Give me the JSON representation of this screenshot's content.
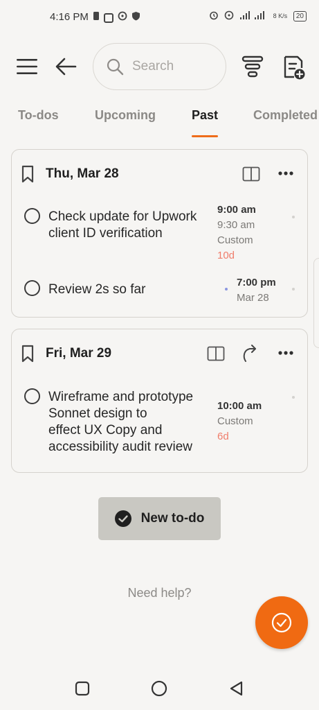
{
  "status_bar": {
    "time": "4:16 PM",
    "network_speed": "8 K/s",
    "battery": "20"
  },
  "header": {
    "search": {
      "placeholder": "Search"
    },
    "icons": [
      "menu-icon",
      "back-arrow-icon",
      "search-icon",
      "filter-icon",
      "new-note-icon"
    ]
  },
  "tabs": [
    {
      "label": "To-dos",
      "active": false
    },
    {
      "label": "Upcoming",
      "active": false
    },
    {
      "label": "Past",
      "active": true
    },
    {
      "label": "Completed",
      "active": false
    }
  ],
  "groups": [
    {
      "date": "Thu, Mar 28",
      "items": [
        {
          "text_lines": [
            "Check update for Upwork",
            "client ID verification"
          ],
          "time": "9:00 am",
          "end_time": "9:30 am",
          "repeat": "Custom",
          "overdue": "10d"
        },
        {
          "text_lines": [
            "Review 2s so far"
          ],
          "time": "7:00 pm",
          "date": "Mar 28"
        }
      ]
    },
    {
      "date": "Fri, Mar 29",
      "items": [
        {
          "text_lines": [
            "Wireframe and prototype",
            "Sonnet design to",
            "effect UX Copy and",
            "accessibility audit review"
          ],
          "time": "10:00 am",
          "repeat": "Custom",
          "overdue": "6d"
        }
      ]
    }
  ],
  "new_todo_label": "New to-do",
  "help_label": "Need help?",
  "colors": {
    "accent": "#ef6c1a",
    "overdue": "#f07d6b",
    "background": "#f6f5f3",
    "button_bg": "#c9c8c2"
  }
}
